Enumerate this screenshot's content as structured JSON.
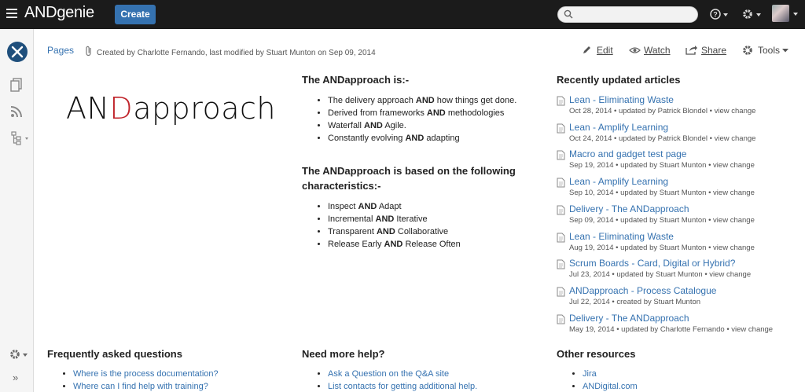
{
  "header": {
    "brand": "ANDgenie",
    "create_label": "Create",
    "search_placeholder": ""
  },
  "page": {
    "breadcrumb": "Pages",
    "byline": "Created by Charlotte Fernando, last modified by Stuart Munton on Sep 09, 2014"
  },
  "actions": {
    "edit": "Edit",
    "watch": "Watch",
    "share": "Share",
    "tools": "Tools"
  },
  "logo": {
    "part1": "AN",
    "part2": "D",
    "part3": "approach"
  },
  "middle": {
    "heading1": "The ANDapproach is:-",
    "items1": [
      {
        "pre": "The delivery approach ",
        "bold": "AND",
        "post": " how things get done."
      },
      {
        "pre": "Derived from frameworks ",
        "bold": "AND",
        "post": " methodologies"
      },
      {
        "pre": "Waterfall ",
        "bold": "AND",
        "post": " Agile."
      },
      {
        "pre": "Constantly evolving ",
        "bold": "AND",
        "post": " adapting"
      }
    ],
    "heading2": "The ANDapproach is based on the following characteristics:-",
    "items2": [
      {
        "pre": "Inspect ",
        "bold": "AND",
        "post": " Adapt"
      },
      {
        "pre": "Incremental ",
        "bold": "AND",
        "post": " Iterative"
      },
      {
        "pre": "Transparent ",
        "bold": "AND",
        "post": " Collaborative"
      },
      {
        "pre": "Release Early ",
        "bold": "AND",
        "post": " Release Often"
      }
    ]
  },
  "recent": {
    "heading": "Recently updated articles",
    "articles": [
      {
        "title": "Lean - Eliminating Waste",
        "meta": "Oct 28, 2014 • updated by Patrick Blondel • view change"
      },
      {
        "title": "Lean - Amplify Learning",
        "meta": "Oct 24, 2014 • updated by Patrick Blondel • view change"
      },
      {
        "title": "Macro and gadget test page",
        "meta": "Sep 19, 2014 • updated by Stuart Munton • view change"
      },
      {
        "title": "Lean - Amplify Learning",
        "meta": "Sep 10, 2014 • updated by Stuart Munton • view change"
      },
      {
        "title": "Delivery - The ANDapproach",
        "meta": "Sep 09, 2014 • updated by Stuart Munton • view change"
      },
      {
        "title": "Lean - Eliminating Waste",
        "meta": "Aug 19, 2014 • updated by Stuart Munton • view change"
      },
      {
        "title": "Scrum Boards - Card, Digital or Hybrid?",
        "meta": "Jul 23, 2014 • updated by Stuart Munton • view change"
      },
      {
        "title": "ANDapproach - Process Catalogue",
        "meta": "Jul 22, 2014 • created by Stuart Munton"
      },
      {
        "title": "Delivery - The ANDapproach",
        "meta": "May 19, 2014 • updated by Charlotte Fernando • view change"
      }
    ]
  },
  "faq": {
    "heading": "Frequently asked questions",
    "links": [
      "Where is the process documentation?",
      "Where can I find help with training?"
    ]
  },
  "help": {
    "heading": "Need more help?",
    "links": [
      "Ask a Question on the Q&A site",
      "List contacts for getting additional help."
    ]
  },
  "resources": {
    "heading": "Other resources",
    "links": [
      "Jira",
      "ANDigital.com"
    ]
  },
  "colors": {
    "link": "#3572b0",
    "header_bg": "#1b1b1b",
    "create_bg": "#3572b0",
    "logo_accent": "#c0232a"
  }
}
